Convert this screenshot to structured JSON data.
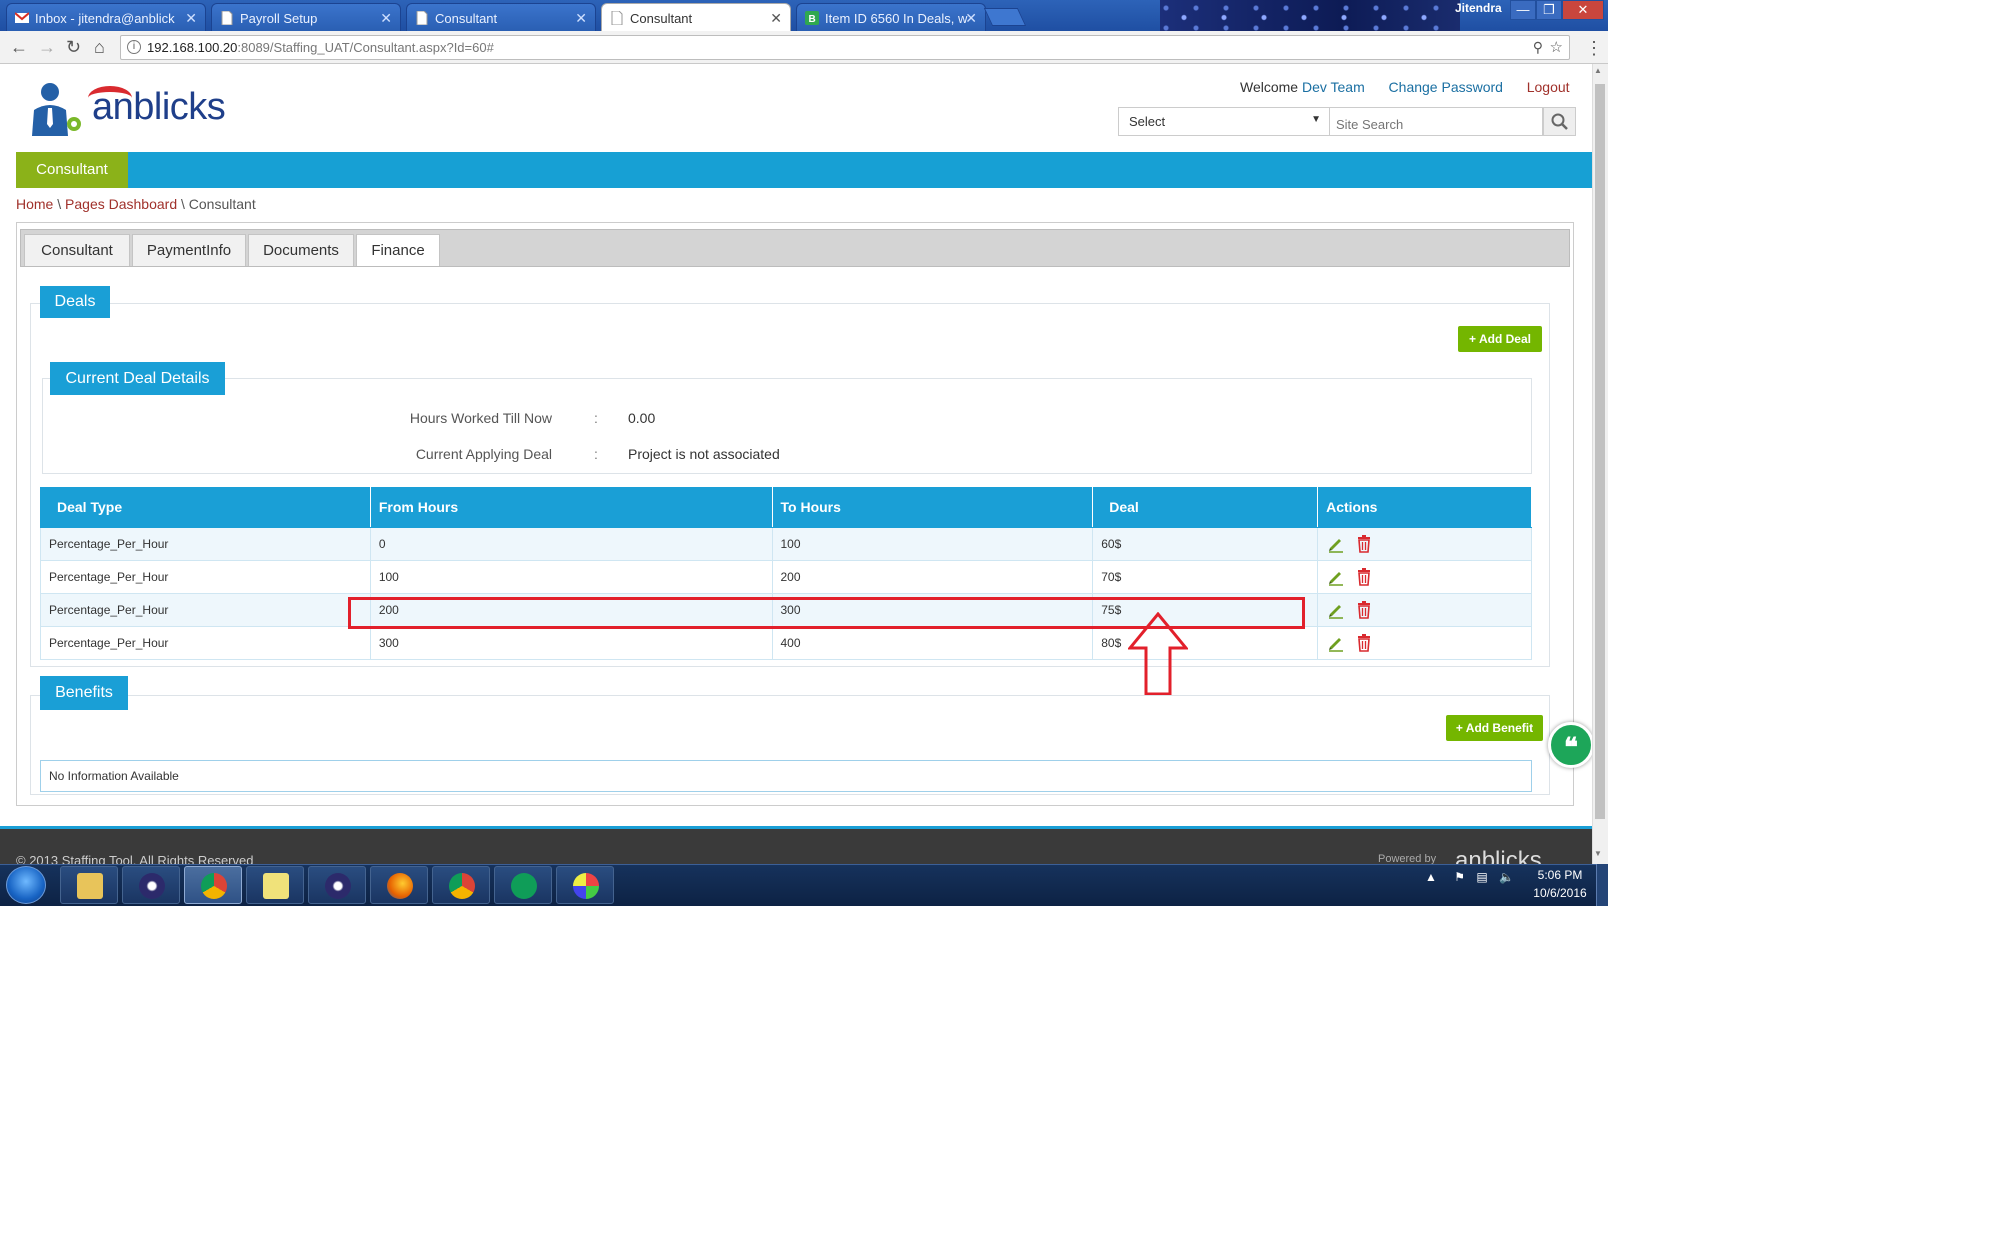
{
  "browser": {
    "tabs": [
      {
        "title": "Inbox - jitendra@anblick",
        "active": false,
        "icon": "gmail-icon"
      },
      {
        "title": "Payroll Setup",
        "active": false,
        "icon": "page-icon"
      },
      {
        "title": "Consultant",
        "active": false,
        "icon": "page-icon"
      },
      {
        "title": "Consultant",
        "active": true,
        "icon": "page-icon"
      },
      {
        "title": "Item ID 6560 In Deals, w",
        "active": false,
        "icon": "b-icon"
      }
    ],
    "user": "Jitendra",
    "window_buttons": {
      "minimize": "—",
      "restore": "❐",
      "close": "✕"
    },
    "url_host": "192.168.100.20",
    "url_rest": ":8089/Staffing_UAT/Consultant.aspx?Id=60#"
  },
  "header": {
    "logo_text": "anblicks",
    "welcome": "Welcome",
    "user_name": "Dev Team",
    "change_password": "Change Password",
    "logout": "Logout",
    "select_value": "Select",
    "search_placeholder": "Site Search"
  },
  "nav": {
    "active_tab": "Consultant"
  },
  "breadcrumb": {
    "home": "Home",
    "sep": "\\",
    "dashboard": "Pages Dashboard",
    "current": "Consultant"
  },
  "page_tabs": [
    "Consultant",
    "PaymentInfo",
    "Documents",
    "Finance"
  ],
  "active_page_tab": "Finance",
  "deals": {
    "title": "Deals",
    "add_button": "+ Add Deal",
    "current_title": "Current Deal Details",
    "hours_label": "Hours Worked Till Now",
    "hours_value": "0.00",
    "applying_label": "Current Applying Deal",
    "applying_value": "Project is not associated",
    "colon": ":",
    "columns": [
      "Deal Type",
      "From Hours",
      "To Hours",
      "Deal",
      "Actions"
    ],
    "rows": [
      {
        "type": "Percentage_Per_Hour",
        "from": "0",
        "to": "100",
        "deal": "60$"
      },
      {
        "type": "Percentage_Per_Hour",
        "from": "100",
        "to": "200",
        "deal": "70$"
      },
      {
        "type": "Percentage_Per_Hour",
        "from": "200",
        "to": "300",
        "deal": "75$"
      },
      {
        "type": "Percentage_Per_Hour",
        "from": "300",
        "to": "400",
        "deal": "80$"
      }
    ]
  },
  "benefits": {
    "title": "Benefits",
    "add_button": "+ Add Benefit",
    "empty": "No Information Available"
  },
  "footer": {
    "copyright": "© 2013 Staffing Tool. All Rights Reserved",
    "powered": "Powered by",
    "logo": "anblicks"
  },
  "taskbar": {
    "time": "5:06 PM",
    "date": "10/6/2016",
    "apps": [
      "explorer",
      "eclipse",
      "chrome",
      "notes",
      "eclipse",
      "firefox",
      "chrome",
      "hangouts",
      "paint"
    ]
  },
  "colors": {
    "accent": "#1a9fd6",
    "green": "#74b600",
    "highlight": "#e2202b",
    "nav_active": "#8bb219"
  }
}
